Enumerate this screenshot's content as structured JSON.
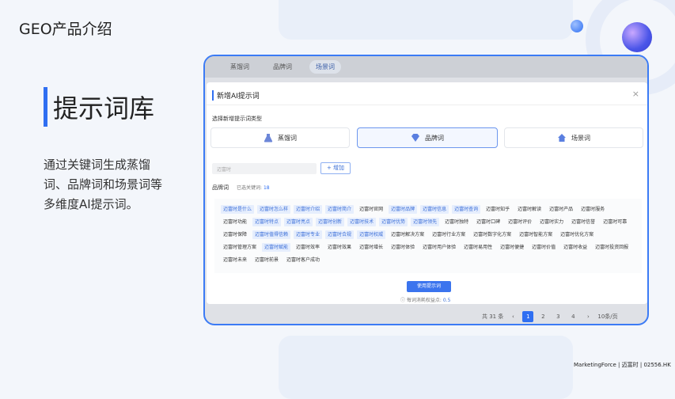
{
  "header": {
    "title": "GEO产品介绍"
  },
  "section": {
    "title": "提示词库",
    "description": "通过关键词生成蒸馏词、品牌词和场景词等多维度AI提示词。"
  },
  "app": {
    "tabs": [
      {
        "label": "蒸馏词"
      },
      {
        "label": "品牌词"
      },
      {
        "label": "场景词",
        "active": true
      }
    ],
    "modal": {
      "title": "新增AI提示词",
      "close": "×",
      "select_type_label": "选择新增提示词类型",
      "types": [
        {
          "label": "蒸馏词",
          "icon": "flask-icon"
        },
        {
          "label": "品牌词",
          "icon": "diamond-icon",
          "active": true
        },
        {
          "label": "场景词",
          "icon": "house-icon"
        }
      ],
      "keyword_input_placeholder": "迈富时",
      "add_button": "+ 增加",
      "brand_label": "品牌词",
      "added_label": "已选关键词:",
      "added_count": "18",
      "keywords": [
        {
          "t": "迈富时是什么",
          "s": true
        },
        {
          "t": "迈富时怎么样",
          "s": true
        },
        {
          "t": "迈富时介绍",
          "s": true
        },
        {
          "t": "迈富时简介",
          "s": true
        },
        {
          "t": "迈富时官网",
          "s": false
        },
        {
          "t": "迈富时品牌",
          "s": true
        },
        {
          "t": "迈富时信息",
          "s": true
        },
        {
          "t": "迈富时查询",
          "s": true
        },
        {
          "t": "迈富时知乎",
          "s": false
        },
        {
          "t": "迈富时解读",
          "s": false
        },
        {
          "t": "迈富时产品",
          "s": false
        },
        {
          "t": "迈富时服务",
          "s": false
        },
        {
          "t": "迈富时功能",
          "s": false
        },
        {
          "t": "迈富时特点",
          "s": true
        },
        {
          "t": "迈富时亮点",
          "s": true
        },
        {
          "t": "迈富时创新",
          "s": true
        },
        {
          "t": "迈富时技术",
          "s": true
        },
        {
          "t": "迈富时优势",
          "s": true
        },
        {
          "t": "迈富时领先",
          "s": true
        },
        {
          "t": "迈富时独特",
          "s": false
        },
        {
          "t": "迈富时口碑",
          "s": false
        },
        {
          "t": "迈富时评价",
          "s": false
        },
        {
          "t": "迈富时实力",
          "s": false
        },
        {
          "t": "迈富时信誉",
          "s": false
        },
        {
          "t": "迈富时可靠",
          "s": false
        },
        {
          "t": "迈富时保障",
          "s": false
        },
        {
          "t": "迈富时值得信赖",
          "s": true
        },
        {
          "t": "迈富时专业",
          "s": true
        },
        {
          "t": "迈富时合规",
          "s": true
        },
        {
          "t": "迈富时权威",
          "s": true
        },
        {
          "t": "迈富时解决方案",
          "s": false
        },
        {
          "t": "迈富时行业方案",
          "s": false
        },
        {
          "t": "迈富时数字化方案",
          "s": false
        },
        {
          "t": "迈富时智能方案",
          "s": false
        },
        {
          "t": "迈富时优化方案",
          "s": false
        },
        {
          "t": "迈富时管理方案",
          "s": false
        },
        {
          "t": "迈富时赋能",
          "s": true
        },
        {
          "t": "迈富时效率",
          "s": false
        },
        {
          "t": "迈富时效果",
          "s": false
        },
        {
          "t": "迈富时增长",
          "s": false
        },
        {
          "t": "迈富时体验",
          "s": false
        },
        {
          "t": "迈富时用户体验",
          "s": false
        },
        {
          "t": "迈富时易用性",
          "s": false
        },
        {
          "t": "迈富时便捷",
          "s": false
        },
        {
          "t": "迈富时价值",
          "s": false
        },
        {
          "t": "迈富时收益",
          "s": false
        },
        {
          "t": "迈富时投资回报",
          "s": false
        },
        {
          "t": "迈富时未来",
          "s": false
        },
        {
          "t": "迈富时前景",
          "s": false
        },
        {
          "t": "迈富时客户成功",
          "s": false
        }
      ],
      "use_button": "使用提示词",
      "hint_text": "每词消耗权益点:",
      "hint_value": "0.5"
    },
    "pager": {
      "total": "共 31 条",
      "pages": [
        "1",
        "2",
        "3",
        "4"
      ],
      "current": "1",
      "page_size": "10条/页"
    }
  },
  "logo": {
    "text": "MarketingForce | 迈富时 | 02556.HK"
  },
  "colors": {
    "accent": "#2f6ff2"
  }
}
